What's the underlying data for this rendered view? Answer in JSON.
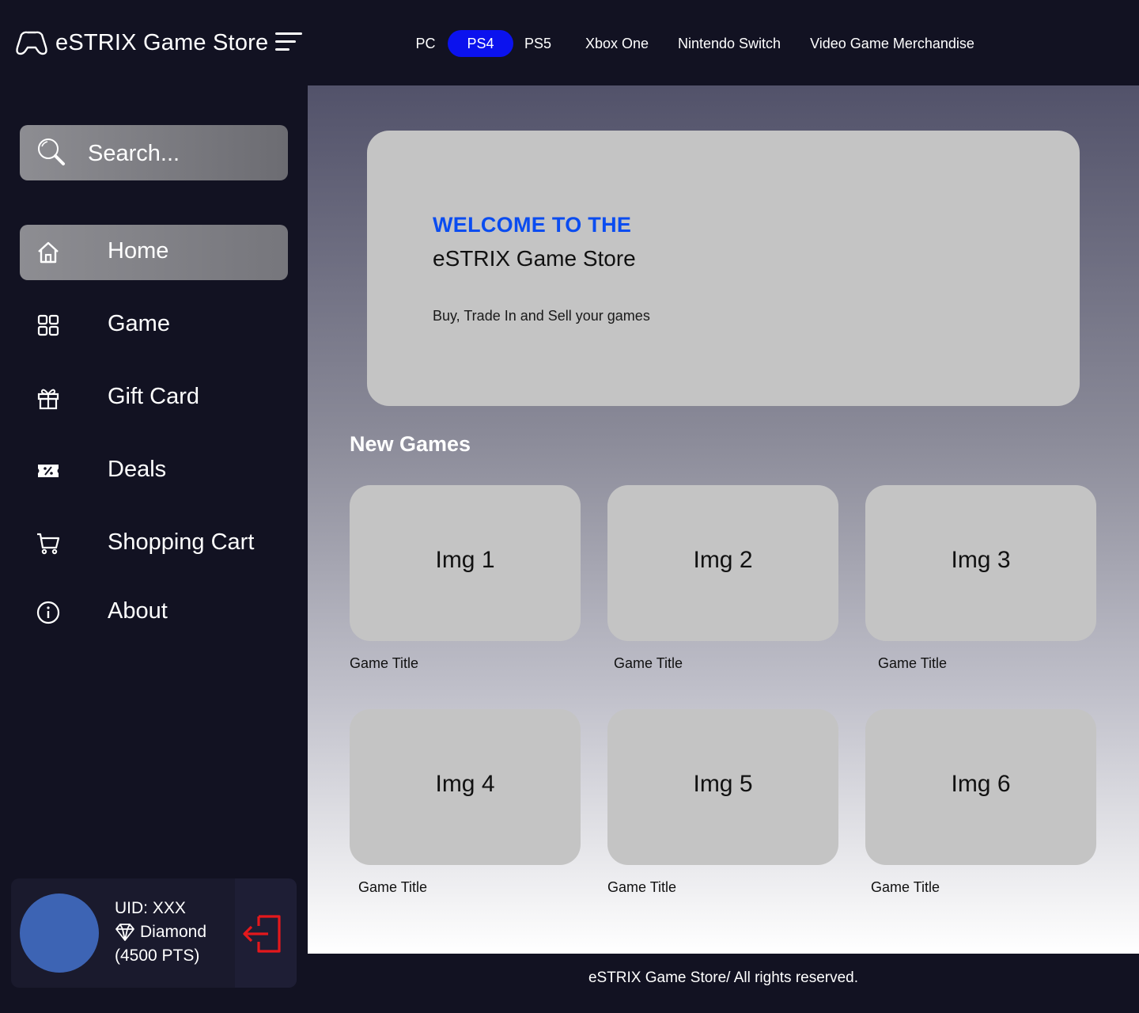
{
  "brand": {
    "name": "eSTRIX Game Store",
    "logo_icon": "gamepad-icon",
    "menu_icon": "menu-icon"
  },
  "platforms": [
    {
      "label": "PC",
      "active": false
    },
    {
      "label": "PS4",
      "active": true
    },
    {
      "label": "PS5",
      "active": false
    },
    {
      "label": "Xbox One",
      "active": false
    },
    {
      "label": "Nintendo Switch",
      "active": false
    },
    {
      "label": "Video Game Merchandise",
      "active": false
    }
  ],
  "search": {
    "placeholder": "Search..."
  },
  "nav": [
    {
      "label": "Home",
      "icon": "home-icon",
      "active": true
    },
    {
      "label": "Game",
      "icon": "grid-icon",
      "active": false
    },
    {
      "label": "Gift Card",
      "icon": "gift-icon",
      "active": false
    },
    {
      "label": "Deals",
      "icon": "ticket-icon",
      "active": false
    },
    {
      "label": "Shopping Cart",
      "icon": "cart-icon",
      "active": false
    },
    {
      "label": "About",
      "icon": "info-icon",
      "active": false
    }
  ],
  "profile": {
    "uid": "UID: XXX",
    "tier": "Diamond",
    "points": "(4500 PTS)",
    "tier_icon": "diamond-icon",
    "logout_icon": "logout-icon",
    "avatar_color": "#3d64b4",
    "logout_color": "#e4181c"
  },
  "hero": {
    "kicker": "WELCOME TO THE",
    "title": "eSTRIX Game Store",
    "subtitle": "Buy, Trade In and Sell your games"
  },
  "new_games": {
    "heading": "New Games",
    "items": [
      {
        "img": "Img 1",
        "title": "Game Title"
      },
      {
        "img": "Img 2",
        "title": "Game Title"
      },
      {
        "img": "Img 3",
        "title": "Game Title"
      },
      {
        "img": "Img 4",
        "title": "Game Title"
      },
      {
        "img": "Img 5",
        "title": "Game Title"
      },
      {
        "img": "Img 6",
        "title": "Game Title"
      }
    ]
  },
  "footer": {
    "text": "eSTRIX Game Store/ All rights reserved."
  },
  "colors": {
    "background": "#121222",
    "accent": "#0b12ee",
    "hero_kicker": "#0a4cf0",
    "card": "#c4c4c4"
  }
}
